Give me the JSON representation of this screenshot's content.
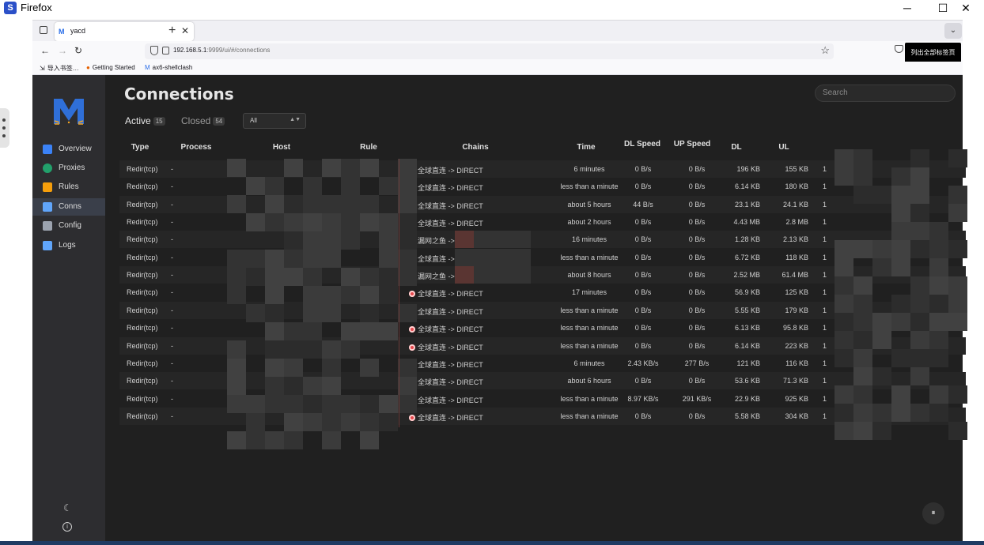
{
  "window": {
    "title": "Firefox",
    "minimize": "─",
    "maximize": "☐",
    "close": "✕"
  },
  "browser": {
    "tab_title": "yacd",
    "url_host": "192.168.5.1",
    "url_path": ":9999/ui/#/connections",
    "tooltip": "列出全部标签页",
    "bookmarks": [
      "导入书签…",
      "Getting Started",
      "ax6-shellclash"
    ]
  },
  "sidebar": {
    "items": [
      {
        "label": "Overview",
        "icon": "chart-icon",
        "color": "#3b82f6"
      },
      {
        "label": "Proxies",
        "icon": "globe-icon",
        "color": "#22a06b"
      },
      {
        "label": "Rules",
        "icon": "ruler-icon",
        "color": "#f59e0b"
      },
      {
        "label": "Conns",
        "icon": "link-icon",
        "color": "#60a5fa"
      },
      {
        "label": "Config",
        "icon": "gear-icon",
        "color": "#9ca3af"
      },
      {
        "label": "Logs",
        "icon": "file-icon",
        "color": "#60a5fa"
      }
    ]
  },
  "page": {
    "title": "Connections",
    "search_placeholder": "Search",
    "tabs": [
      {
        "label": "Active",
        "count": "15"
      },
      {
        "label": "Closed",
        "count": "54"
      }
    ],
    "filter_value": "All",
    "pause_label": "⏸"
  },
  "table": {
    "headers": [
      "Type",
      "Process",
      "Host",
      "Rule",
      "Chains",
      "Time",
      "DL Speed",
      "UP Speed",
      "DL",
      "UL"
    ],
    "rows": [
      {
        "type": "Redir(tcp)",
        "process": "-",
        "chain": "全球直连 -> DIRECT",
        "icon": "target",
        "time": "6 minutes",
        "dls": "0 B/s",
        "ups": "0 B/s",
        "dl": "196 KB",
        "ul": "155 KB",
        "extra": "1"
      },
      {
        "type": "Redir(tcp)",
        "process": "-",
        "chain": "全球直连 -> DIRECT",
        "icon": "target",
        "time": "less than a minute",
        "dls": "0 B/s",
        "ups": "0 B/s",
        "dl": "6.14 KB",
        "ul": "180 KB",
        "extra": "1"
      },
      {
        "type": "Redir(tcp)",
        "process": "-",
        "chain": "全球直连 -> DIRECT",
        "icon": "target",
        "time": "about 5 hours",
        "dls": "44 B/s",
        "ups": "0 B/s",
        "dl": "23.1 KB",
        "ul": "24.1 KB",
        "extra": "1"
      },
      {
        "type": "Redir(tcp)",
        "process": "-",
        "chain": "全球直连 -> DIRECT",
        "icon": "target",
        "time": "about 2 hours",
        "dls": "0 B/s",
        "ups": "0 B/s",
        "dl": "4.43 MB",
        "ul": "2.8 MB",
        "extra": "1"
      },
      {
        "type": "Redir(tcp)",
        "process": "-",
        "chain": "漏网之鱼 ->",
        "icon": "fish",
        "time": "16 minutes",
        "dls": "0 B/s",
        "ups": "0 B/s",
        "dl": "1.28 KB",
        "ul": "2.13 KB",
        "extra": "1"
      },
      {
        "type": "Redir(tcp)",
        "process": "-",
        "chain": "全球直连 ->",
        "icon": "target",
        "time": "less than a minute",
        "dls": "0 B/s",
        "ups": "0 B/s",
        "dl": "6.72 KB",
        "ul": "118 KB",
        "extra": "1"
      },
      {
        "type": "Redir(tcp)",
        "process": "-",
        "chain": "漏网之鱼 ->",
        "icon": "fish",
        "time": "about 8 hours",
        "dls": "0 B/s",
        "ups": "0 B/s",
        "dl": "2.52 MB",
        "ul": "61.4 MB",
        "extra": "1"
      },
      {
        "type": "Redir(tcp)",
        "process": "-",
        "chain": "全球直连 -> DIRECT",
        "icon": "target",
        "time": "17 minutes",
        "dls": "0 B/s",
        "ups": "0 B/s",
        "dl": "56.9 KB",
        "ul": "125 KB",
        "extra": "1"
      },
      {
        "type": "Redir(tcp)",
        "process": "-",
        "chain": "全球直连 -> DIRECT",
        "icon": "target",
        "time": "less than a minute",
        "dls": "0 B/s",
        "ups": "0 B/s",
        "dl": "5.55 KB",
        "ul": "179 KB",
        "extra": "1"
      },
      {
        "type": "Redir(tcp)",
        "process": "-",
        "chain": "全球直连 -> DIRECT",
        "icon": "target",
        "time": "less than a minute",
        "dls": "0 B/s",
        "ups": "0 B/s",
        "dl": "6.13 KB",
        "ul": "95.8 KB",
        "extra": "1"
      },
      {
        "type": "Redir(tcp)",
        "process": "-",
        "chain": "全球直连 -> DIRECT",
        "icon": "target",
        "time": "less than a minute",
        "dls": "0 B/s",
        "ups": "0 B/s",
        "dl": "6.14 KB",
        "ul": "223 KB",
        "extra": "1"
      },
      {
        "type": "Redir(tcp)",
        "process": "-",
        "chain": "全球直连 -> DIRECT",
        "icon": "target",
        "time": "6 minutes",
        "dls": "2.43 KB/s",
        "ups": "277 B/s",
        "dl": "121 KB",
        "ul": "116 KB",
        "extra": "1"
      },
      {
        "type": "Redir(tcp)",
        "process": "-",
        "chain": "全球直连 -> DIRECT",
        "icon": "target",
        "time": "about 6 hours",
        "dls": "0 B/s",
        "ups": "0 B/s",
        "dl": "53.6 KB",
        "ul": "71.3 KB",
        "extra": "1"
      },
      {
        "type": "Redir(tcp)",
        "process": "-",
        "chain": "全球直连 -> DIRECT",
        "icon": "target",
        "time": "less than a minute",
        "dls": "8.97 KB/s",
        "ups": "291 KB/s",
        "dl": "22.9 KB",
        "ul": "925 KB",
        "extra": "1"
      },
      {
        "type": "Redir(tcp)",
        "process": "-",
        "chain": "全球直连 -> DIRECT",
        "icon": "target",
        "time": "less than a minute",
        "dls": "0 B/s",
        "ups": "0 B/s",
        "dl": "5.58 KB",
        "ul": "304 KB",
        "extra": "1"
      }
    ]
  }
}
